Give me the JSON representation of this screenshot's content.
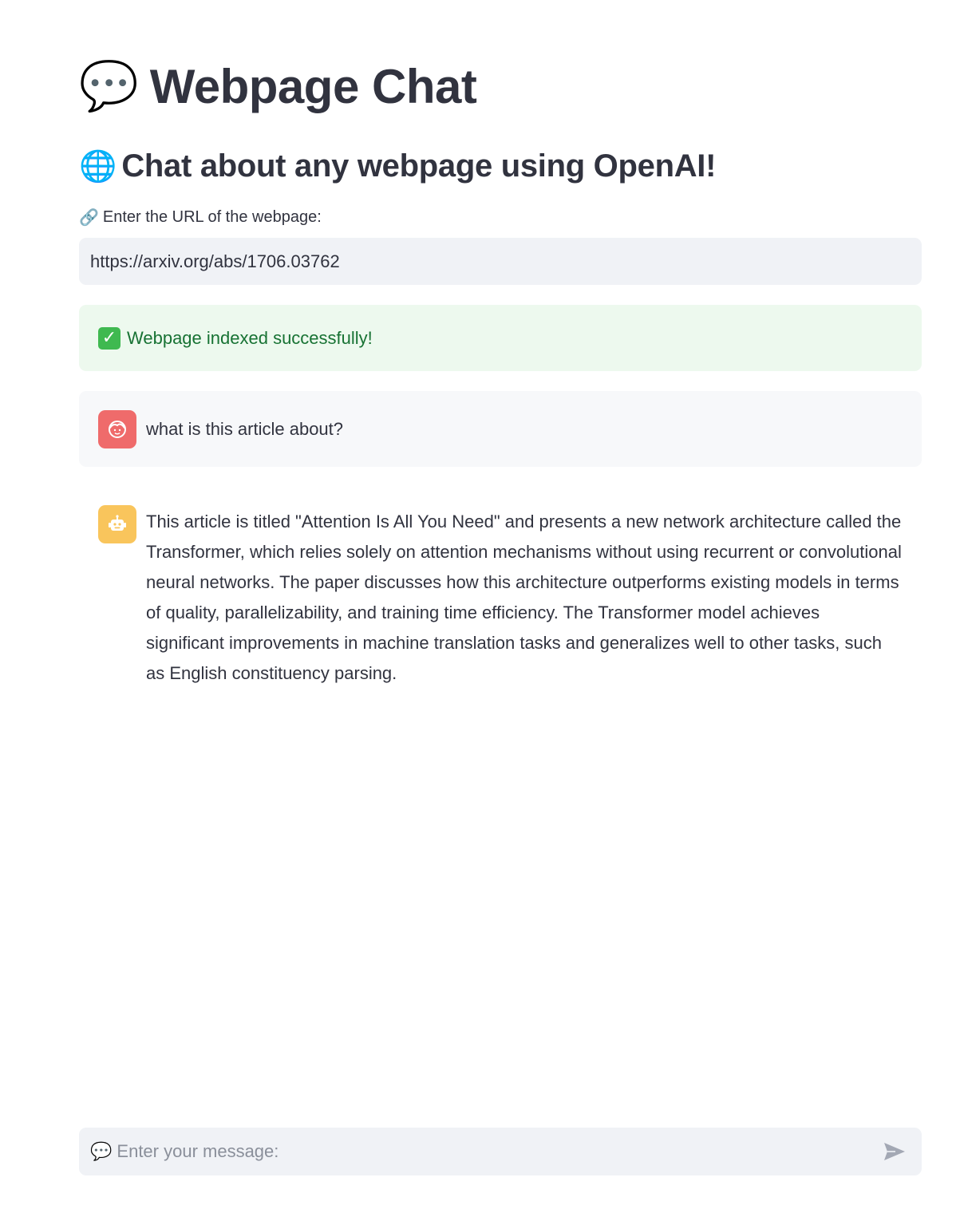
{
  "header": {
    "title_emoji": "💬",
    "title": "Webpage Chat",
    "subtitle_emoji": "🌐",
    "subtitle": "Chat about any webpage using OpenAI!"
  },
  "url_field": {
    "label_emoji": "🔗",
    "label": "Enter the URL of the webpage:",
    "value": "https://arxiv.org/abs/1706.03762"
  },
  "status": {
    "icon": "✓",
    "message": "Webpage indexed successfully!"
  },
  "messages": [
    {
      "role": "user",
      "avatar_icon": "user-face-icon",
      "text": "what is this article about?"
    },
    {
      "role": "assistant",
      "avatar_icon": "robot-icon",
      "text": "This article is titled \"Attention Is All You Need\" and presents a new network architecture called the Transformer, which relies solely on attention mechanisms without using recurrent or convolutional neural networks. The paper discusses how this architecture outperforms existing models in terms of quality, parallelizability, and training time efficiency. The Transformer model achieves significant improvements in machine translation tasks and generalizes well to other tasks, such as English constituency parsing."
    }
  ],
  "chat_input": {
    "emoji": "💬",
    "placeholder": "Enter your message:"
  },
  "colors": {
    "success_bg": "#edf9ee",
    "success_text": "#177233",
    "user_avatar": "#ef6b6b",
    "bot_avatar": "#f9c55c",
    "input_bg": "#f0f2f6"
  }
}
